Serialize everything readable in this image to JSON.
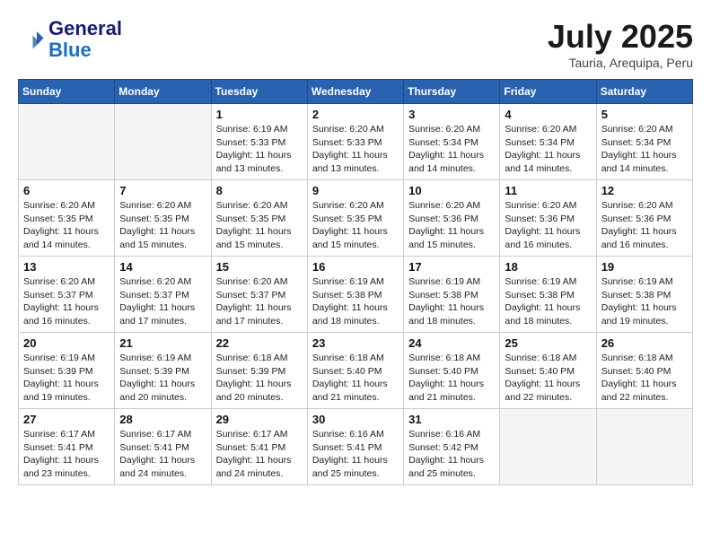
{
  "header": {
    "logo_line1": "General",
    "logo_line2": "Blue",
    "month_title": "July 2025",
    "location": "Tauria, Arequipa, Peru"
  },
  "days_of_week": [
    "Sunday",
    "Monday",
    "Tuesday",
    "Wednesday",
    "Thursday",
    "Friday",
    "Saturday"
  ],
  "weeks": [
    [
      {
        "day": "",
        "empty": true
      },
      {
        "day": "",
        "empty": true
      },
      {
        "day": "1",
        "sunrise": "6:19 AM",
        "sunset": "5:33 PM",
        "daylight": "11 hours and 13 minutes."
      },
      {
        "day": "2",
        "sunrise": "6:20 AM",
        "sunset": "5:33 PM",
        "daylight": "11 hours and 13 minutes."
      },
      {
        "day": "3",
        "sunrise": "6:20 AM",
        "sunset": "5:34 PM",
        "daylight": "11 hours and 14 minutes."
      },
      {
        "day": "4",
        "sunrise": "6:20 AM",
        "sunset": "5:34 PM",
        "daylight": "11 hours and 14 minutes."
      },
      {
        "day": "5",
        "sunrise": "6:20 AM",
        "sunset": "5:34 PM",
        "daylight": "11 hours and 14 minutes."
      }
    ],
    [
      {
        "day": "6",
        "sunrise": "6:20 AM",
        "sunset": "5:35 PM",
        "daylight": "11 hours and 14 minutes."
      },
      {
        "day": "7",
        "sunrise": "6:20 AM",
        "sunset": "5:35 PM",
        "daylight": "11 hours and 15 minutes."
      },
      {
        "day": "8",
        "sunrise": "6:20 AM",
        "sunset": "5:35 PM",
        "daylight": "11 hours and 15 minutes."
      },
      {
        "day": "9",
        "sunrise": "6:20 AM",
        "sunset": "5:35 PM",
        "daylight": "11 hours and 15 minutes."
      },
      {
        "day": "10",
        "sunrise": "6:20 AM",
        "sunset": "5:36 PM",
        "daylight": "11 hours and 15 minutes."
      },
      {
        "day": "11",
        "sunrise": "6:20 AM",
        "sunset": "5:36 PM",
        "daylight": "11 hours and 16 minutes."
      },
      {
        "day": "12",
        "sunrise": "6:20 AM",
        "sunset": "5:36 PM",
        "daylight": "11 hours and 16 minutes."
      }
    ],
    [
      {
        "day": "13",
        "sunrise": "6:20 AM",
        "sunset": "5:37 PM",
        "daylight": "11 hours and 16 minutes."
      },
      {
        "day": "14",
        "sunrise": "6:20 AM",
        "sunset": "5:37 PM",
        "daylight": "11 hours and 17 minutes."
      },
      {
        "day": "15",
        "sunrise": "6:20 AM",
        "sunset": "5:37 PM",
        "daylight": "11 hours and 17 minutes."
      },
      {
        "day": "16",
        "sunrise": "6:19 AM",
        "sunset": "5:38 PM",
        "daylight": "11 hours and 18 minutes."
      },
      {
        "day": "17",
        "sunrise": "6:19 AM",
        "sunset": "5:38 PM",
        "daylight": "11 hours and 18 minutes."
      },
      {
        "day": "18",
        "sunrise": "6:19 AM",
        "sunset": "5:38 PM",
        "daylight": "11 hours and 18 minutes."
      },
      {
        "day": "19",
        "sunrise": "6:19 AM",
        "sunset": "5:38 PM",
        "daylight": "11 hours and 19 minutes."
      }
    ],
    [
      {
        "day": "20",
        "sunrise": "6:19 AM",
        "sunset": "5:39 PM",
        "daylight": "11 hours and 19 minutes."
      },
      {
        "day": "21",
        "sunrise": "6:19 AM",
        "sunset": "5:39 PM",
        "daylight": "11 hours and 20 minutes."
      },
      {
        "day": "22",
        "sunrise": "6:18 AM",
        "sunset": "5:39 PM",
        "daylight": "11 hours and 20 minutes."
      },
      {
        "day": "23",
        "sunrise": "6:18 AM",
        "sunset": "5:40 PM",
        "daylight": "11 hours and 21 minutes."
      },
      {
        "day": "24",
        "sunrise": "6:18 AM",
        "sunset": "5:40 PM",
        "daylight": "11 hours and 21 minutes."
      },
      {
        "day": "25",
        "sunrise": "6:18 AM",
        "sunset": "5:40 PM",
        "daylight": "11 hours and 22 minutes."
      },
      {
        "day": "26",
        "sunrise": "6:18 AM",
        "sunset": "5:40 PM",
        "daylight": "11 hours and 22 minutes."
      }
    ],
    [
      {
        "day": "27",
        "sunrise": "6:17 AM",
        "sunset": "5:41 PM",
        "daylight": "11 hours and 23 minutes."
      },
      {
        "day": "28",
        "sunrise": "6:17 AM",
        "sunset": "5:41 PM",
        "daylight": "11 hours and 24 minutes."
      },
      {
        "day": "29",
        "sunrise": "6:17 AM",
        "sunset": "5:41 PM",
        "daylight": "11 hours and 24 minutes."
      },
      {
        "day": "30",
        "sunrise": "6:16 AM",
        "sunset": "5:41 PM",
        "daylight": "11 hours and 25 minutes."
      },
      {
        "day": "31",
        "sunrise": "6:16 AM",
        "sunset": "5:42 PM",
        "daylight": "11 hours and 25 minutes."
      },
      {
        "day": "",
        "empty": true
      },
      {
        "day": "",
        "empty": true
      }
    ]
  ]
}
